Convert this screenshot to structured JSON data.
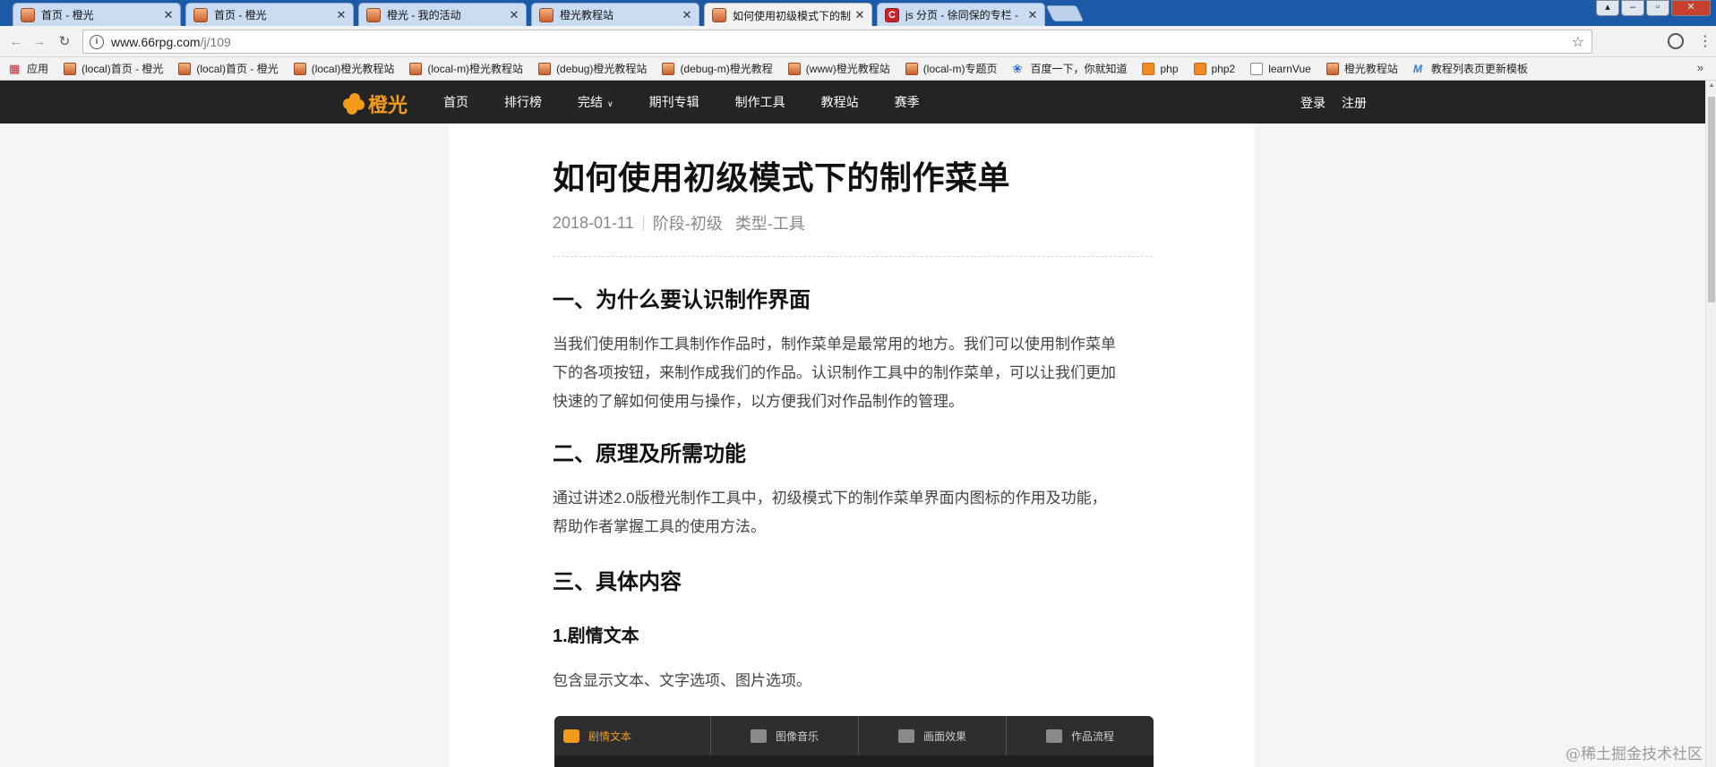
{
  "browser": {
    "tabs": [
      {
        "title": "首页 - 橙光"
      },
      {
        "title": "首页 - 橙光"
      },
      {
        "title": "橙光 - 我的活动"
      },
      {
        "title": "橙光教程站"
      },
      {
        "title": "如何使用初级模式下的制"
      },
      {
        "title": "js 分页 - 徐同保的专栏 -"
      }
    ],
    "url_host": "www.66rpg.com",
    "url_path": "/j/109",
    "bookmarks": [
      {
        "label": "应用",
        "icon": "apps-icon"
      },
      {
        "label": "(local)首页 - 橙光",
        "icon": "site-icon"
      },
      {
        "label": "(local)首页 - 橙光",
        "icon": "site-icon"
      },
      {
        "label": "(local)橙光教程站",
        "icon": "site-icon"
      },
      {
        "label": "(local-m)橙光教程站",
        "icon": "site-icon"
      },
      {
        "label": "(debug)橙光教程站",
        "icon": "site-icon"
      },
      {
        "label": "(debug-m)橙光教程",
        "icon": "site-icon"
      },
      {
        "label": "(www)橙光教程站",
        "icon": "site-icon"
      },
      {
        "label": "(local-m)专题页",
        "icon": "site-icon"
      },
      {
        "label": "百度一下，你就知道",
        "icon": "paw-icon"
      },
      {
        "label": "php",
        "icon": "orange-icon"
      },
      {
        "label": "php2",
        "icon": "orange-icon"
      },
      {
        "label": "learnVue",
        "icon": "doc-icon"
      },
      {
        "label": "橙光教程站",
        "icon": "site-icon"
      },
      {
        "label": "教程列表页更新模板",
        "icon": "m-icon"
      }
    ]
  },
  "site": {
    "logo_text": "橙光",
    "nav": [
      "首页",
      "排行榜",
      "完结",
      "期刊专辑",
      "制作工具",
      "教程站",
      "赛季"
    ],
    "login": "登录",
    "register": "注册"
  },
  "article": {
    "title": "如何使用初级模式下的制作菜单",
    "date": "2018-01-11",
    "tags": [
      "阶段-初级",
      "类型-工具"
    ],
    "s1_heading": "一、为什么要认识制作界面",
    "s1_lines": [
      "当我们使用制作工具制作作品时，制作菜单是最常用的地方。我们可以使用制作菜单",
      "下的各项按钮，来制作成我们的作品。认识制作工具中的制作菜单，可以让我们更加",
      "快速的了解如何使用与操作，以方便我们对作品制作的管理。"
    ],
    "s2_heading": "二、原理及所需功能",
    "s2_lines": [
      "通过讲述2.0版橙光制作工具中，初级模式下的制作菜单界面内图标的作用及功能，",
      "帮助作者掌握工具的使用方法。"
    ],
    "s3_heading": "三、具体内容",
    "sub1_heading": "1.剧情文本",
    "sub1_text": "包含显示文本、文字选项、图片选项。",
    "demo_tabs": [
      "剧情文本",
      "图像音乐",
      "画面效果",
      "作品流程"
    ]
  },
  "watermark": "@稀土掘金技术社区"
}
